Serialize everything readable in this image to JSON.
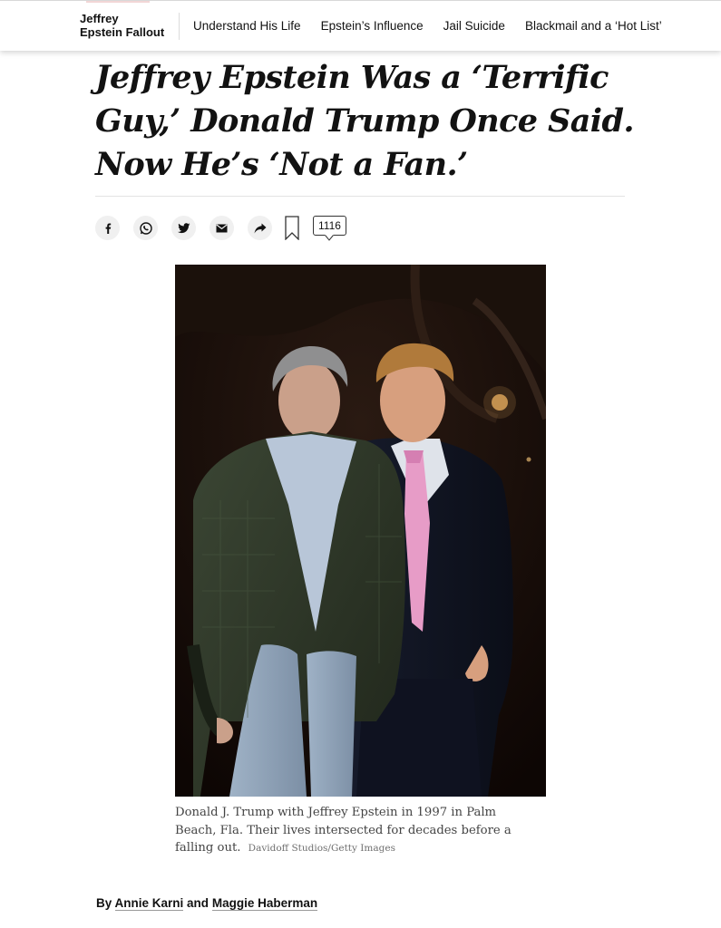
{
  "nav": {
    "series_title_line1": "Jeffrey",
    "series_title_line2": "Epstein Fallout",
    "links": [
      "Understand His Life",
      "Epstein’s Influence",
      "Jail Suicide",
      "Blackmail and a ‘Hot List’"
    ]
  },
  "article": {
    "headline": "Jeffrey Epstein Was a ‘Terrific Guy,’ Donald Trump Once Said. Now He’s ‘Not a Fan.’",
    "comment_count": "1116",
    "caption": "Donald J. Trump with Jeffrey Epstein in 1997 in Palm Beach, Fla. Their lives intersected for decades before a falling out.",
    "credit": "Davidoff Studios/Getty Images",
    "byline_prefix": "By",
    "author1": "Annie Karni",
    "byline_and": "and",
    "author2": "Maggie Haberman"
  },
  "share_icons": [
    "facebook-icon",
    "whatsapp-icon",
    "twitter-icon",
    "email-icon",
    "share-arrow-icon",
    "bookmark-icon",
    "comment-icon"
  ],
  "colors": {
    "text": "#121212",
    "caption": "#444444",
    "share_bg": "#f0f0f0"
  }
}
